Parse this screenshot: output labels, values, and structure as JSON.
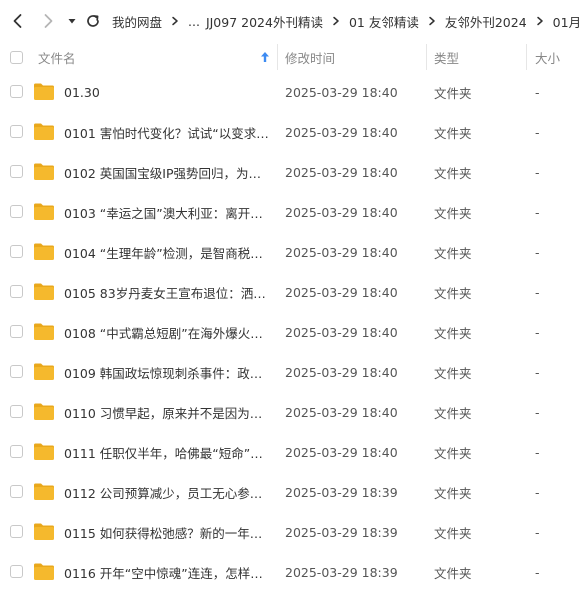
{
  "nav": {
    "breadcrumb": [
      "我的网盘",
      "...",
      "JJ097 2024外刊精读",
      "01 友邻精读",
      "友邻外刊2024",
      "01月"
    ]
  },
  "header": {
    "name": "文件名",
    "modified": "修改时间",
    "type": "类型",
    "size": "大小"
  },
  "rows": [
    {
      "name": "01.30",
      "time": "2025-03-29 18:40",
      "type": "文件夹",
      "size": "-"
    },
    {
      "name": "0101 害怕时代变化？试试“以变求…",
      "time": "2025-03-29 18:40",
      "type": "文件夹",
      "size": "-"
    },
    {
      "name": "0102 英国国宝级IP强势回归，为什…",
      "time": "2025-03-29 18:40",
      "type": "文件夹",
      "size": "-"
    },
    {
      "name": "0103 “幸运之国”澳大利亚：离开…",
      "time": "2025-03-29 18:40",
      "type": "文件夹",
      "size": "-"
    },
    {
      "name": "0104 “生理年龄”检测，是智商税…",
      "time": "2025-03-29 18:40",
      "type": "文件夹",
      "size": "-"
    },
    {
      "name": "0105 83岁丹麦女王宣布退位：洒脱…",
      "time": "2025-03-29 18:40",
      "type": "文件夹",
      "size": "-"
    },
    {
      "name": "0108 “中式霸总短剧”在海外爆火…",
      "time": "2025-03-29 18:40",
      "type": "文件夹",
      "size": "-"
    },
    {
      "name": "0109 韩国政坛惊现刺杀事件：政治…",
      "time": "2025-03-29 18:40",
      "type": "文件夹",
      "size": "-"
    },
    {
      "name": "0110 习惯早起，原来并不是因为自…",
      "time": "2025-03-29 18:40",
      "type": "文件夹",
      "size": "-"
    },
    {
      "name": "0111 任职仅半年，哈佛最“短命”…",
      "time": "2025-03-29 18:40",
      "type": "文件夹",
      "size": "-"
    },
    {
      "name": "0112 公司预算减少，员工无心参加…",
      "time": "2025-03-29 18:39",
      "type": "文件夹",
      "size": "-"
    },
    {
      "name": "0115 如何获得松弛感？新的一年要…",
      "time": "2025-03-29 18:39",
      "type": "文件夹",
      "size": "-"
    },
    {
      "name": "0116 开年“空中惊魂”连连，怎样…",
      "time": "2025-03-29 18:39",
      "type": "文件夹",
      "size": "-"
    }
  ],
  "colors": {
    "folder": "#F5B92D",
    "folder_tab": "#E9A81C",
    "sort_arrow": "#3D8BF2"
  },
  "icons": {
    "back": "chevron-left-icon",
    "forward": "chevron-right-icon",
    "dropdown": "caret-down-icon",
    "refresh": "refresh-icon",
    "separator": "chevron-right-icon",
    "sort": "sort-up-arrow-icon",
    "folder": "folder-icon"
  }
}
